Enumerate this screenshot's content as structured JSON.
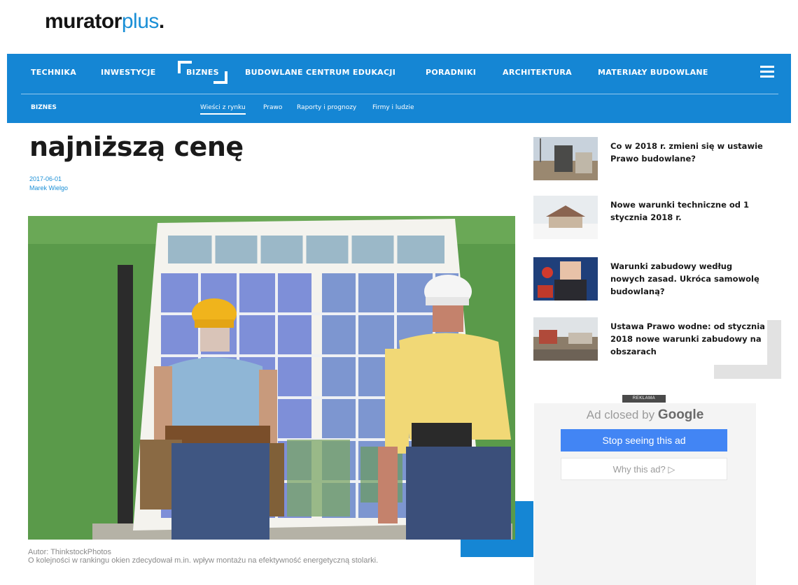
{
  "logo": {
    "part1": "murator",
    "part2": "plus",
    "part3": "."
  },
  "nav": {
    "items": [
      {
        "label": "TECHNIKA"
      },
      {
        "label": "INWESTYCJE"
      },
      {
        "label": "BIZNES"
      },
      {
        "label": "BUDOWLANE CENTRUM EDUKACJI"
      },
      {
        "label": "PORADNIKI"
      },
      {
        "label": "ARCHITEKTURA"
      },
      {
        "label": "MATERIAŁY BUDOWLANE"
      }
    ],
    "active_index": 2,
    "menu_icon": "hamburger-icon",
    "sub": {
      "section": "BIZNES",
      "items": [
        {
          "label": "Wieści z rynku"
        },
        {
          "label": "Prawo"
        },
        {
          "label": "Raporty i prognozy"
        },
        {
          "label": "Firmy i ludzie"
        }
      ],
      "active_index": 0
    }
  },
  "article": {
    "title": "najniższą cenę",
    "date": "2017-06-01",
    "author": "Marek Wielgo",
    "photo_credit": "Autor: ThinkstockPhotos",
    "caption": "O kolejności w rankingu okien zdecydował m.in. wpływ montażu na efektywność energetyczną stolarki."
  },
  "sidebar": {
    "items": [
      {
        "title": "Co w 2018 r. zmieni się w ustawie Prawo budowlane?"
      },
      {
        "title": "Nowe warunki techniczne od 1 stycznia 2018 r."
      },
      {
        "title": "Warunki zabudowy według nowych zasad. Ukróca samowolę budowlaną?"
      },
      {
        "title": "Ustawa Prawo wodne: od stycznia 2018 nowe warunki zabudowy na obszarach"
      }
    ]
  },
  "ad": {
    "label": "REKLAMA",
    "closed_prefix": "Ad closed by",
    "closed_brand": "Google",
    "stop_label": "Stop seeing this ad",
    "why_label": "Why this ad? ▷"
  },
  "colors": {
    "brand_blue": "#1586d4",
    "accent_blue": "#1a8fd6",
    "ad_button": "#4285f4"
  }
}
